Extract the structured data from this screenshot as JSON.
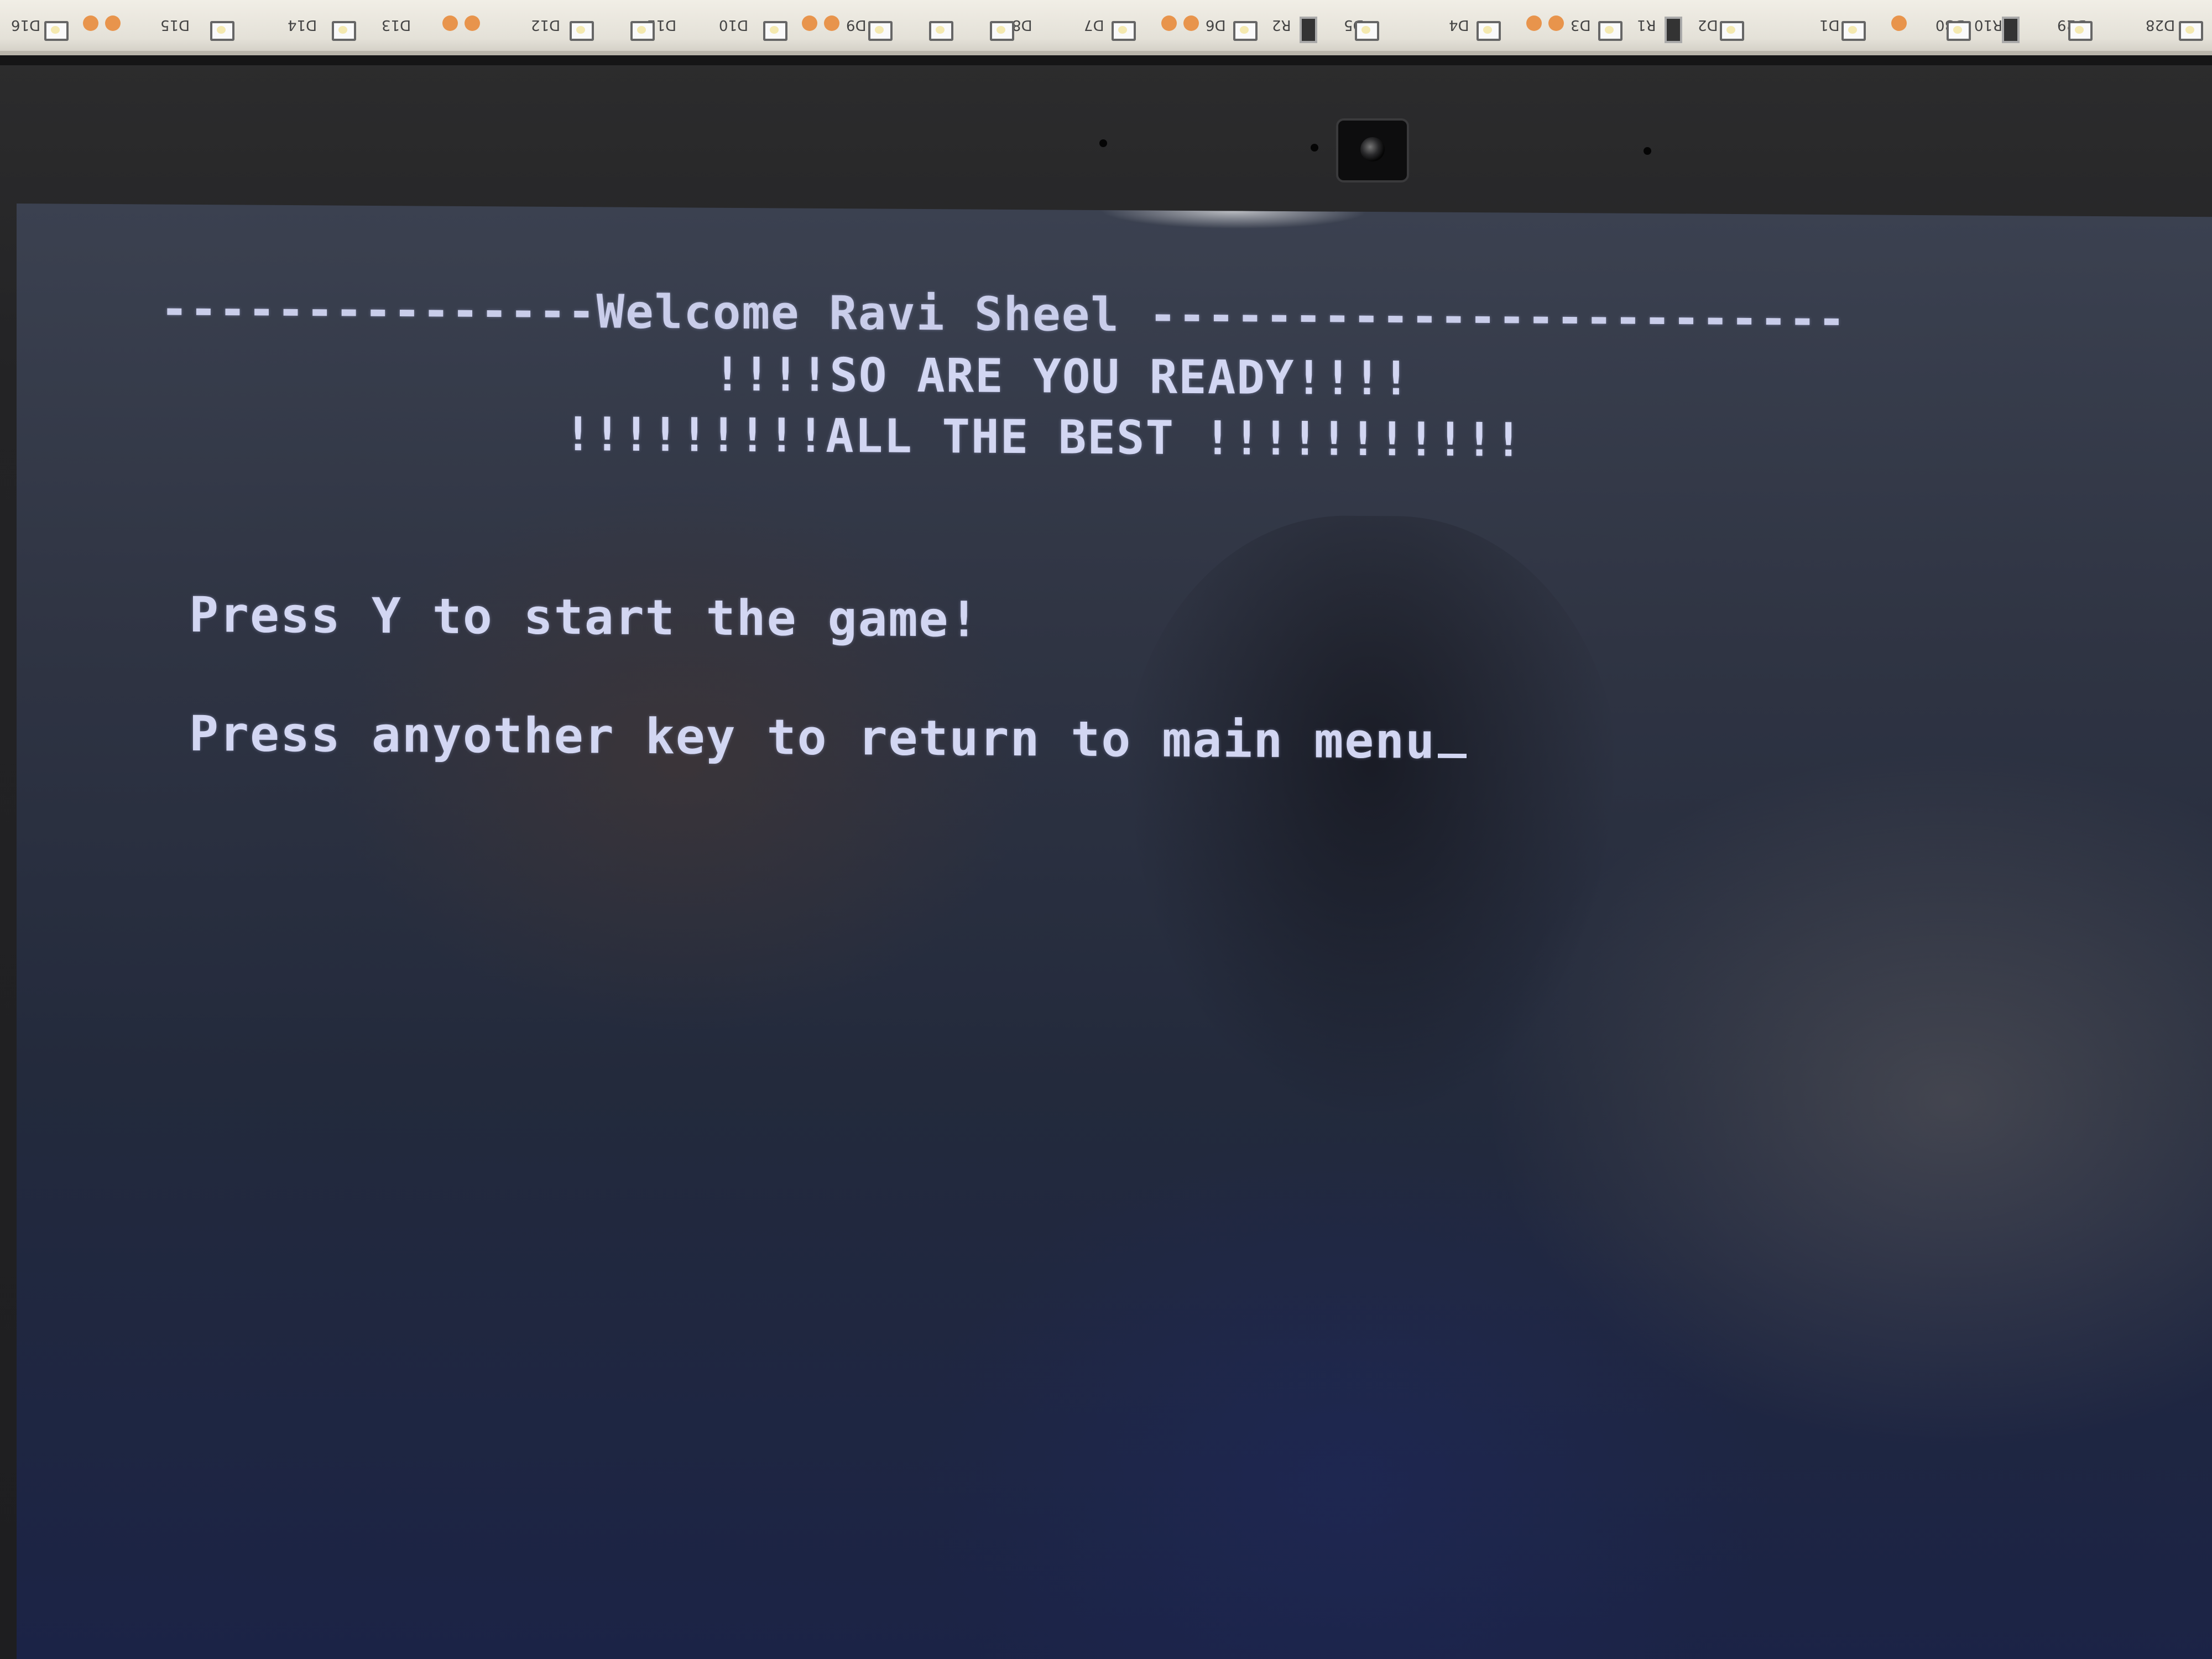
{
  "led_strip": {
    "labels": [
      "D16",
      "D15",
      "D14",
      "D13",
      "D12",
      "D11",
      "D10",
      "D9",
      "D8",
      "D7",
      "D6",
      "R2",
      "D5",
      "D4",
      "D3",
      "R1",
      "D2",
      "D1",
      "D30",
      "R10",
      "D29",
      "D28"
    ]
  },
  "terminal": {
    "welcome_banner": "---------------Welcome Ravi Sheel ------------------------",
    "ready_line": "!!!!SO ARE YOU READY!!!!",
    "best_line": "!!!!!!!!!ALL THE BEST !!!!!!!!!!!",
    "prompt_start": "Press Y to start the game!",
    "prompt_return": "Press anyother key to return to main menu"
  }
}
